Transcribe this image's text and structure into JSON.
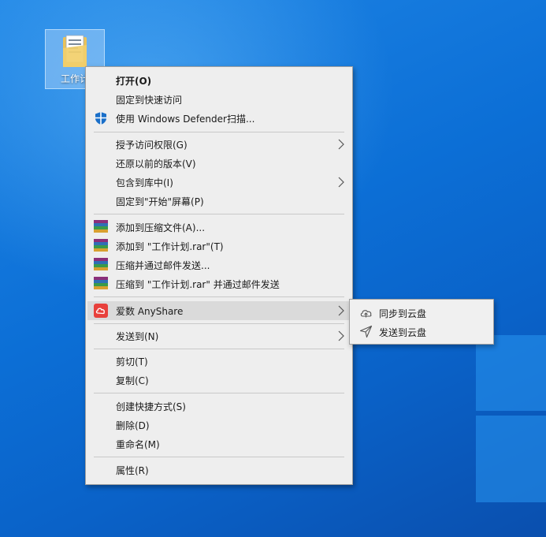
{
  "desktop": {
    "icon_label": "工作计"
  },
  "menu": {
    "open": "打开(O)",
    "pin_quick": "固定到快速访问",
    "defender": "使用 Windows Defender扫描...",
    "give_access": "授予访问权限(G)",
    "restore": "还原以前的版本(V)",
    "include_library": "包含到库中(I)",
    "pin_start": "固定到\"开始\"屏幕(P)",
    "add_archive": "添加到压缩文件(A)...",
    "add_rar": "添加到 \"工作计划.rar\"(T)",
    "compress_email": "压缩并通过邮件发送...",
    "compress_rar_email": "压缩到 \"工作计划.rar\" 并通过邮件发送",
    "anyshare": "爱数 AnyShare",
    "send_to": "发送到(N)",
    "cut": "剪切(T)",
    "copy": "复制(C)",
    "create_shortcut": "创建快捷方式(S)",
    "delete": "删除(D)",
    "rename": "重命名(M)",
    "properties": "属性(R)"
  },
  "submenu": {
    "sync_cloud": "同步到云盘",
    "send_cloud": "发送到云盘"
  },
  "colors": {
    "desktop_blue": "#0c6fd6",
    "menu_bg": "#eeeeee",
    "hover": "#dadada",
    "anyshare_red": "#e8403b"
  }
}
